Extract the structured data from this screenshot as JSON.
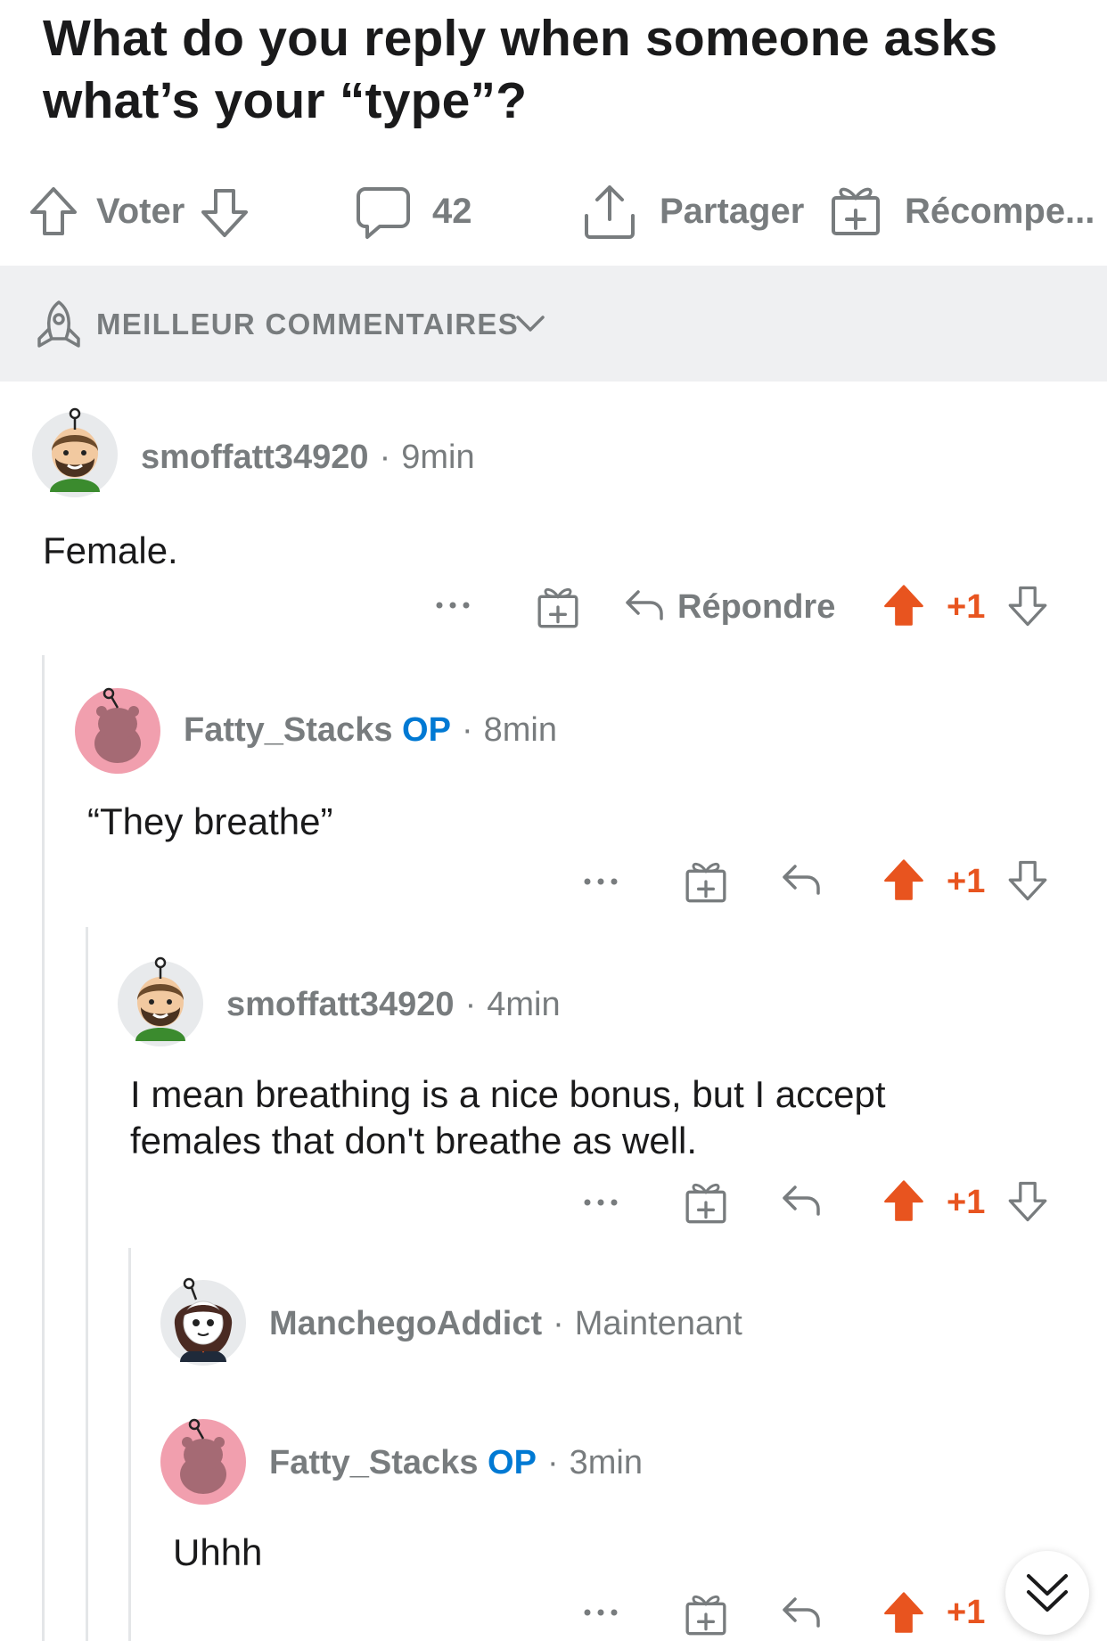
{
  "post": {
    "title": "What do you reply when someone asks what’s your “type”?"
  },
  "action_bar": {
    "vote_label": "Voter",
    "comments_count": "42",
    "share_label": "Partager",
    "award_label": "Récompe..."
  },
  "sort": {
    "label": "MEILLEUR COMMENTAIRES"
  },
  "colors": {
    "upvote": "#e8541f",
    "op": "#0079d3",
    "muted": "#787c7e",
    "thread_line": "#e4e6e8"
  },
  "comments": [
    {
      "username": "smoffatt34920",
      "op_badge": "",
      "time": "9min",
      "body": "Female.",
      "reply_label": "Répondre",
      "score": "+1"
    },
    {
      "username": "Fatty_Stacks",
      "op_badge": "OP",
      "time": "8min",
      "body": "“They breathe”",
      "reply_label": "",
      "score": "+1"
    },
    {
      "username": "smoffatt34920",
      "op_badge": "",
      "time": "4min",
      "body": "I mean breathing is a nice bonus, but I accept females that don't breathe as well.",
      "reply_label": "",
      "score": "+1"
    },
    {
      "username": "ManchegoAddict",
      "op_badge": "",
      "time": "Maintenant",
      "body": "",
      "reply_label": "",
      "score": ""
    },
    {
      "username": "Fatty_Stacks",
      "op_badge": "OP",
      "time": "3min",
      "body": "Uhhh",
      "reply_label": "",
      "score": "+1"
    }
  ],
  "icons": {
    "upvote": "arrow-up-outline",
    "downvote": "arrow-down-outline",
    "comment": "speech-bubble",
    "share": "share-upload",
    "award": "gift-box",
    "sort": "rocket",
    "more": "ellipsis",
    "reply": "reply-arrow",
    "scroll": "double-chevron-down"
  }
}
